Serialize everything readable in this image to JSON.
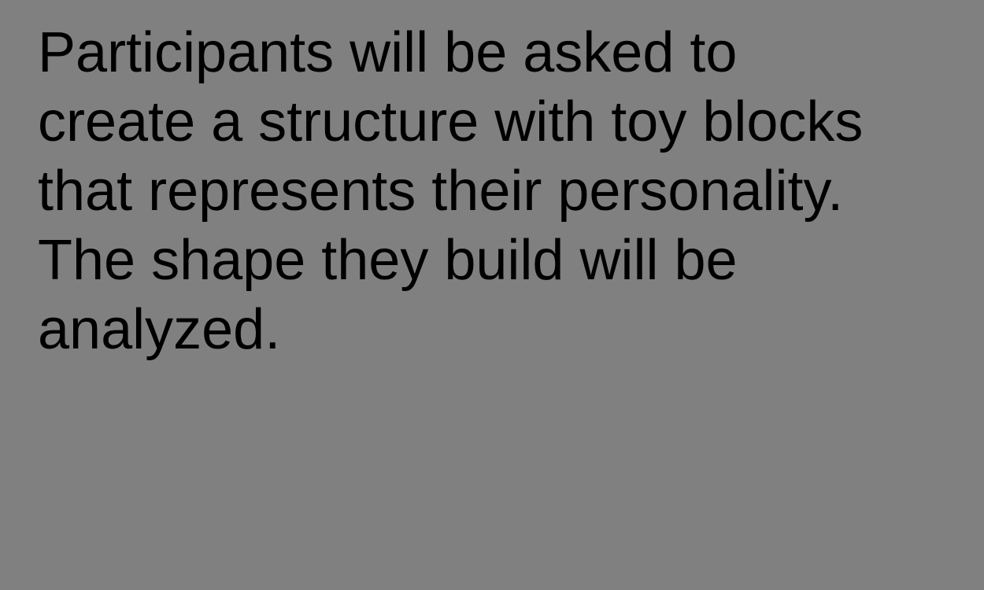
{
  "colors": {
    "background": "#808080",
    "text": "#000000"
  },
  "instruction": {
    "lines": [
      "Participants will be asked to",
      "create a structure with toy blocks",
      "that represents their personality.",
      "The shape they build will be",
      "analyzed."
    ]
  }
}
